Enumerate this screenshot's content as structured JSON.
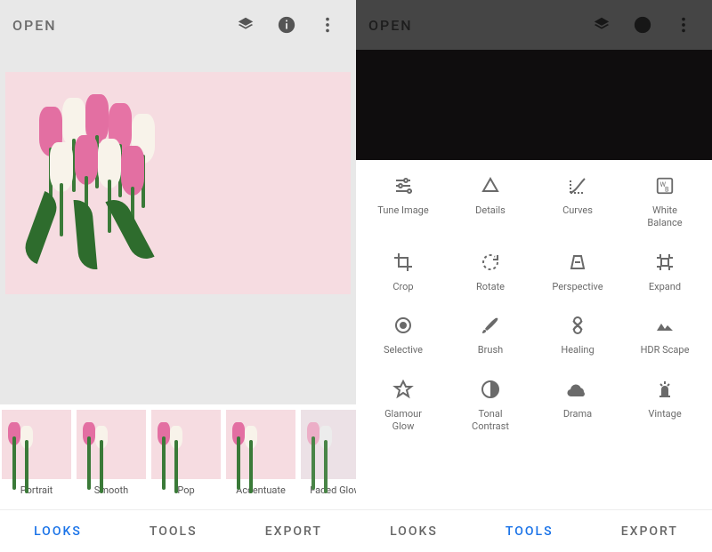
{
  "left": {
    "topbar": {
      "title": "OPEN"
    },
    "looks": [
      {
        "label": "Portrait"
      },
      {
        "label": "Smooth"
      },
      {
        "label": "Pop"
      },
      {
        "label": "Accentuate"
      },
      {
        "label": "Faded Glow"
      }
    ],
    "nav": {
      "looks": "LOOKS",
      "tools": "TOOLS",
      "export": "EXPORT",
      "active": "looks"
    }
  },
  "right": {
    "topbar": {
      "title": "OPEN"
    },
    "tools": [
      {
        "name": "tune-image",
        "label": "Tune Image"
      },
      {
        "name": "details",
        "label": "Details"
      },
      {
        "name": "curves",
        "label": "Curves"
      },
      {
        "name": "white-balance",
        "label": "White\nBalance"
      },
      {
        "name": "crop",
        "label": "Crop"
      },
      {
        "name": "rotate",
        "label": "Rotate"
      },
      {
        "name": "perspective",
        "label": "Perspective"
      },
      {
        "name": "expand",
        "label": "Expand"
      },
      {
        "name": "selective",
        "label": "Selective"
      },
      {
        "name": "brush",
        "label": "Brush"
      },
      {
        "name": "healing",
        "label": "Healing"
      },
      {
        "name": "hdr-scape",
        "label": "HDR Scape"
      },
      {
        "name": "glamour-glow",
        "label": "Glamour\nGlow"
      },
      {
        "name": "tonal-contrast",
        "label": "Tonal\nContrast"
      },
      {
        "name": "drama",
        "label": "Drama"
      },
      {
        "name": "vintage",
        "label": "Vintage"
      }
    ],
    "nav": {
      "looks": "LOOKS",
      "tools": "TOOLS",
      "export": "EXPORT",
      "active": "tools"
    }
  }
}
